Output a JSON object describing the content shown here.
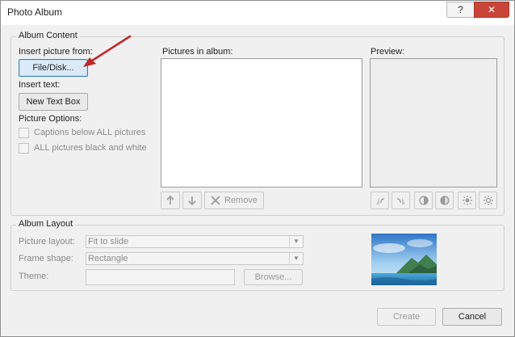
{
  "window": {
    "title": "Photo Album",
    "help_glyph": "?",
    "close_glyph": "✕"
  },
  "album_content": {
    "legend": "Album Content",
    "insert_picture_from": "Insert picture from:",
    "file_disk_button": "File/Disk...",
    "insert_text": "Insert text:",
    "new_text_box_button": "New Text Box",
    "picture_options": "Picture Options:",
    "captions_below": "Captions below ALL pictures",
    "all_black_white": "ALL pictures black and white",
    "pictures_in_album": "Pictures in album:",
    "preview": "Preview:",
    "remove_button": "Remove"
  },
  "album_layout": {
    "legend": "Album Layout",
    "picture_layout_label": "Picture layout:",
    "picture_layout_value": "Fit to slide",
    "frame_shape_label": "Frame shape:",
    "frame_shape_value": "Rectangle",
    "theme_label": "Theme:",
    "browse_button": "Browse..."
  },
  "footer": {
    "create_button": "Create",
    "cancel_button": "Cancel"
  },
  "colors": {
    "annotation_arrow": "#c0282a",
    "close_button": "#c9453a",
    "primary_border": "#3c7fb1"
  }
}
